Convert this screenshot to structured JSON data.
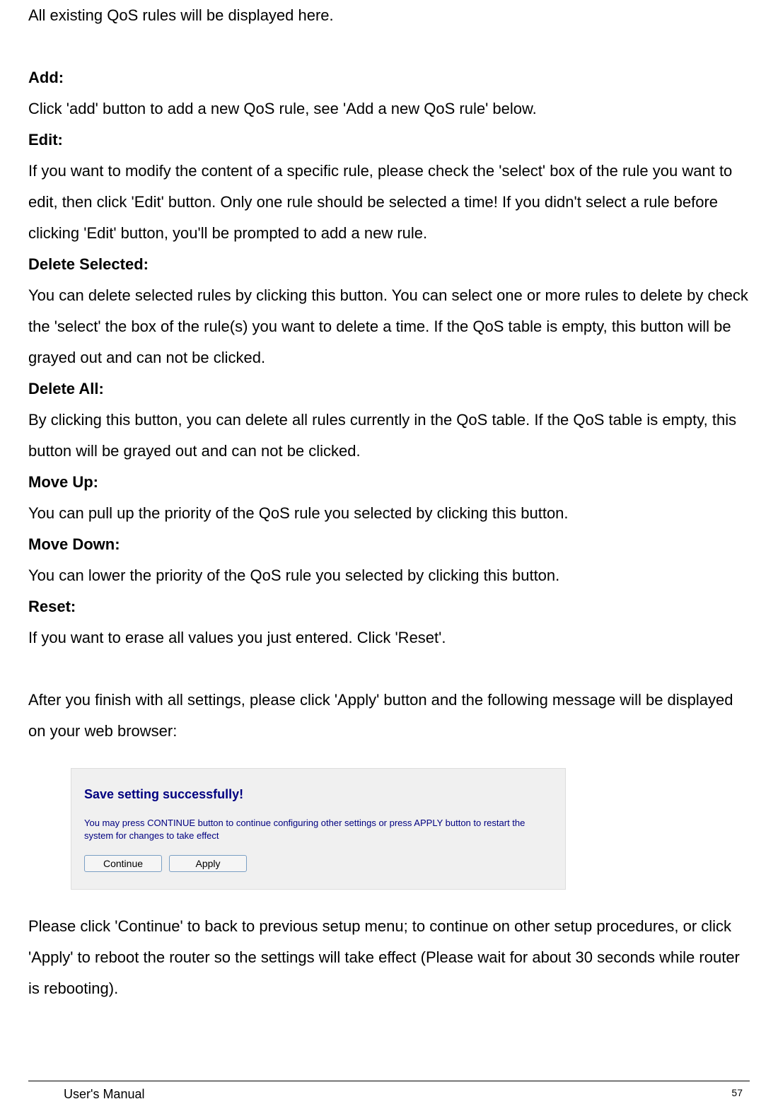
{
  "intro": "All existing QoS rules will be displayed here.",
  "definitions": [
    {
      "term": "Add:",
      "desc": "Click 'add' button to add a new QoS rule, see 'Add a new QoS rule' below."
    },
    {
      "term": "Edit:",
      "desc": "If you want to modify the content of a specific rule, please check the 'select' box of the rule you want to edit, then click 'Edit' button. Only one rule should be selected a time! If you didn't select a rule before clicking 'Edit' button, you'll be prompted to add a new rule."
    },
    {
      "term": "Delete Selected:",
      "desc": "You can delete selected rules by clicking this button. You can select one or more rules to delete by check the 'select' the box of the rule(s) you want to delete a time. If the QoS table is empty, this button will be grayed out and can not be clicked."
    },
    {
      "term": "Delete All:",
      "desc": "By clicking this button, you can delete all rules currently in the QoS table. If the QoS table is empty, this button will be grayed out and can not be clicked."
    },
    {
      "term": "Move Up:",
      "desc": "You can pull up the priority of the QoS rule you selected by clicking this button."
    },
    {
      "term": "Move Down:",
      "desc": "You can lower the priority of the QoS rule you selected by clicking this button."
    },
    {
      "term": "Reset:",
      "desc": "If you want to erase all values you just entered. Click 'Reset'."
    }
  ],
  "apply_note": "After you finish with all settings, please click 'Apply' button and the following message will be displayed on your web browser:",
  "dialog": {
    "title": "Save setting successfully!",
    "text": "You may press CONTINUE button to continue configuring other settings or press APPLY button to restart the system for changes to take effect",
    "continue_label": "Continue",
    "apply_label": "Apply"
  },
  "closing": "Please click 'Continue' to back to previous setup menu; to continue on other setup procedures, or click 'Apply' to reboot the router so the settings will take effect (Please wait for about 30 seconds while router is rebooting).",
  "footer": {
    "label": "User's Manual",
    "page": "57"
  }
}
